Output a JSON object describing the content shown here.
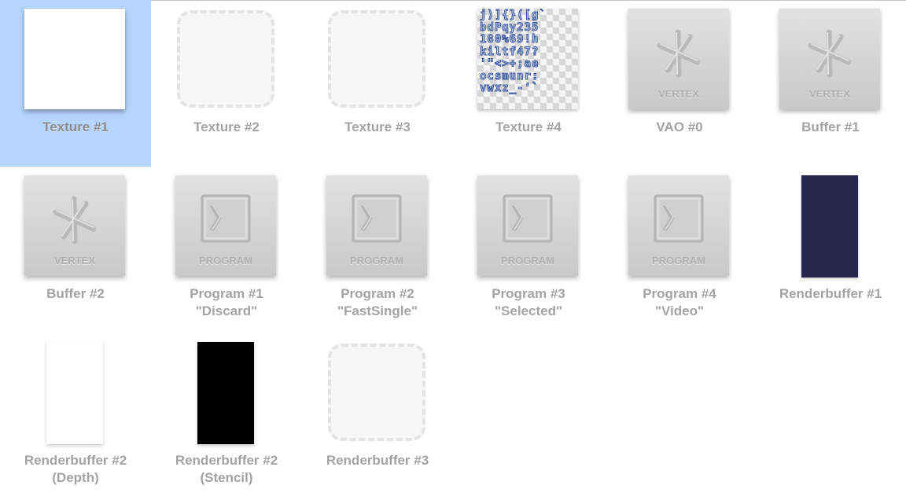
{
  "items": [
    {
      "id": "texture-1",
      "kind": "texture",
      "lines": [
        "Texture #1",
        ""
      ],
      "selected": true
    },
    {
      "id": "texture-2",
      "kind": "texture-empty",
      "lines": [
        "Texture #2",
        ""
      ]
    },
    {
      "id": "texture-3",
      "kind": "texture-empty",
      "lines": [
        "Texture #3",
        ""
      ]
    },
    {
      "id": "texture-4",
      "kind": "texture-font",
      "lines": [
        "Texture #4",
        ""
      ],
      "font_rows": [
        "j)]{}([g`",
        "bdPqy235",
        "180%69!h",
        "kiltf47?",
        "'\"<>+;ae",
        "ocsmunr:",
        "vwxz_-'`"
      ]
    },
    {
      "id": "vao-0",
      "kind": "vertex",
      "lines": [
        "VAO #0",
        ""
      ],
      "caption": "VERTEX"
    },
    {
      "id": "buffer-1",
      "kind": "vertex",
      "lines": [
        "Buffer #1",
        ""
      ],
      "caption": "VERTEX"
    },
    {
      "id": "buffer-2",
      "kind": "vertex",
      "lines": [
        "Buffer #2",
        ""
      ],
      "caption": "VERTEX"
    },
    {
      "id": "program-1",
      "kind": "program",
      "lines": [
        "Program #1",
        "\"Discard\""
      ],
      "caption": "PROGRAM"
    },
    {
      "id": "program-2",
      "kind": "program",
      "lines": [
        "Program #2",
        "\"FastSingle\""
      ],
      "caption": "PROGRAM"
    },
    {
      "id": "program-3",
      "kind": "program",
      "lines": [
        "Program #3",
        "\"Selected\""
      ],
      "caption": "PROGRAM"
    },
    {
      "id": "program-4",
      "kind": "program",
      "lines": [
        "Program #4",
        "\"Video\""
      ],
      "caption": "PROGRAM"
    },
    {
      "id": "renderbuffer-1",
      "kind": "renderbuffer",
      "lines": [
        "Renderbuffer #1",
        ""
      ],
      "color": "#25264a"
    },
    {
      "id": "renderbuffer-2-depth",
      "kind": "renderbuffer",
      "lines": [
        "Renderbuffer #2",
        "(Depth)"
      ],
      "color": "#ffffff"
    },
    {
      "id": "renderbuffer-2-stencil",
      "kind": "renderbuffer",
      "lines": [
        "Renderbuffer #2",
        "(Stencil)"
      ],
      "color": "#000000"
    },
    {
      "id": "renderbuffer-3",
      "kind": "texture-empty",
      "lines": [
        "Renderbuffer #3",
        ""
      ]
    }
  ],
  "colors": {
    "selection": "#b5d5fd",
    "label": "#a3a3a3"
  }
}
